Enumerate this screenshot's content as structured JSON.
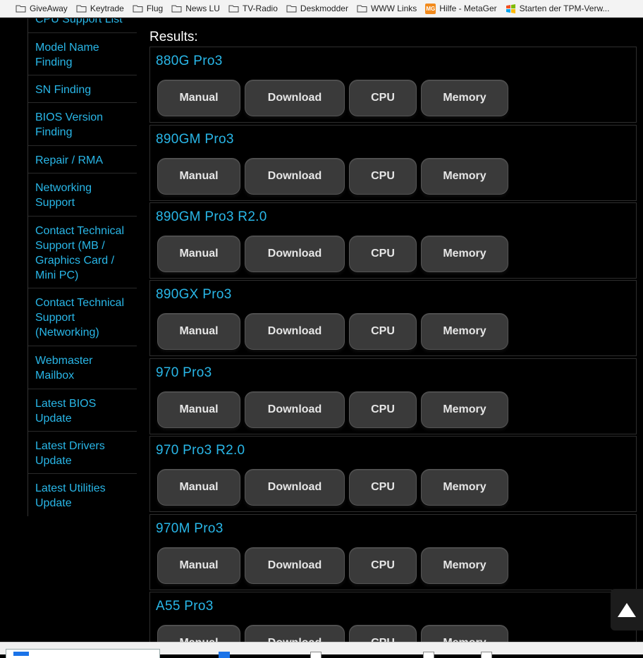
{
  "bookmarks": [
    {
      "label": "GiveAway",
      "icon": "folder-icon"
    },
    {
      "label": "Keytrade",
      "icon": "folder-icon"
    },
    {
      "label": "Flug",
      "icon": "folder-icon"
    },
    {
      "label": "News LU",
      "icon": "folder-icon"
    },
    {
      "label": "TV-Radio",
      "icon": "folder-icon"
    },
    {
      "label": "Deskmodder",
      "icon": "folder-icon"
    },
    {
      "label": "WWW Links",
      "icon": "folder-icon"
    },
    {
      "label": "Hilfe - MetaGer",
      "icon": "metager-icon",
      "icon_text": "MG"
    },
    {
      "label": "Starten der TPM-Verw...",
      "icon": "windows-flag-icon"
    }
  ],
  "sidebar": {
    "items": [
      {
        "lines": [
          "CPU Support List"
        ]
      },
      {
        "lines": [
          "Model Name",
          "Finding"
        ]
      },
      {
        "lines": [
          "SN Finding"
        ]
      },
      {
        "lines": [
          "BIOS Version",
          "Finding"
        ]
      },
      {
        "lines": [
          "Repair / RMA"
        ]
      },
      {
        "lines": [
          "Networking",
          "Support"
        ]
      },
      {
        "lines": [
          "Contact Technical",
          "Support (MB /",
          "Graphics Card /",
          "Mini PC)"
        ]
      },
      {
        "lines": [
          "Contact Technical",
          "Support",
          "(Networking)"
        ]
      },
      {
        "lines": [
          "Webmaster",
          "Mailbox"
        ]
      },
      {
        "lines": [
          "Latest BIOS",
          "Update"
        ]
      },
      {
        "lines": [
          "Latest Drivers",
          "Update"
        ]
      },
      {
        "lines": [
          "Latest Utilities",
          "Update"
        ]
      }
    ]
  },
  "main": {
    "results_label": "Results:",
    "buttons": {
      "manual": "Manual",
      "download": "Download",
      "cpu": "CPU",
      "memory": "Memory"
    },
    "cards": [
      {
        "title": "880G Pro3"
      },
      {
        "title": "890GM Pro3"
      },
      {
        "title": "890GM Pro3 R2.0"
      },
      {
        "title": "890GX Pro3"
      },
      {
        "title": "970 Pro3"
      },
      {
        "title": "970 Pro3 R2.0"
      },
      {
        "title": "970M Pro3"
      },
      {
        "title": "A55 Pro3"
      }
    ]
  },
  "scroll_top": {
    "icon": "arrow-up-icon"
  },
  "colors": {
    "accent": "#29b7e8",
    "button_bg": "#3a3a3a",
    "background": "#000000"
  }
}
